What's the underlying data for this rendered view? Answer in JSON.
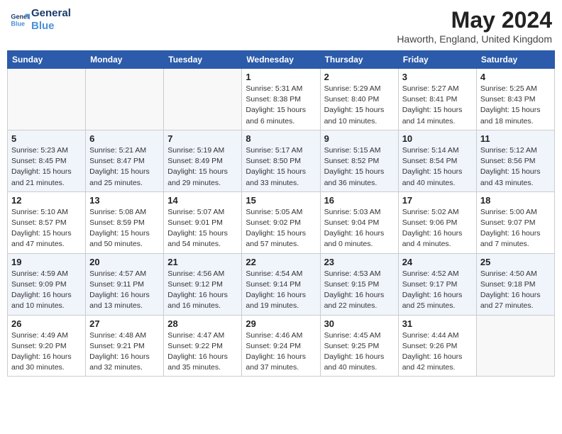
{
  "header": {
    "logo_line1": "General",
    "logo_line2": "Blue",
    "month_year": "May 2024",
    "location": "Haworth, England, United Kingdom"
  },
  "weekdays": [
    "Sunday",
    "Monday",
    "Tuesday",
    "Wednesday",
    "Thursday",
    "Friday",
    "Saturday"
  ],
  "weeks": [
    [
      {
        "day": "",
        "info": ""
      },
      {
        "day": "",
        "info": ""
      },
      {
        "day": "",
        "info": ""
      },
      {
        "day": "1",
        "info": "Sunrise: 5:31 AM\nSunset: 8:38 PM\nDaylight: 15 hours\nand 6 minutes."
      },
      {
        "day": "2",
        "info": "Sunrise: 5:29 AM\nSunset: 8:40 PM\nDaylight: 15 hours\nand 10 minutes."
      },
      {
        "day": "3",
        "info": "Sunrise: 5:27 AM\nSunset: 8:41 PM\nDaylight: 15 hours\nand 14 minutes."
      },
      {
        "day": "4",
        "info": "Sunrise: 5:25 AM\nSunset: 8:43 PM\nDaylight: 15 hours\nand 18 minutes."
      }
    ],
    [
      {
        "day": "5",
        "info": "Sunrise: 5:23 AM\nSunset: 8:45 PM\nDaylight: 15 hours\nand 21 minutes."
      },
      {
        "day": "6",
        "info": "Sunrise: 5:21 AM\nSunset: 8:47 PM\nDaylight: 15 hours\nand 25 minutes."
      },
      {
        "day": "7",
        "info": "Sunrise: 5:19 AM\nSunset: 8:49 PM\nDaylight: 15 hours\nand 29 minutes."
      },
      {
        "day": "8",
        "info": "Sunrise: 5:17 AM\nSunset: 8:50 PM\nDaylight: 15 hours\nand 33 minutes."
      },
      {
        "day": "9",
        "info": "Sunrise: 5:15 AM\nSunset: 8:52 PM\nDaylight: 15 hours\nand 36 minutes."
      },
      {
        "day": "10",
        "info": "Sunrise: 5:14 AM\nSunset: 8:54 PM\nDaylight: 15 hours\nand 40 minutes."
      },
      {
        "day": "11",
        "info": "Sunrise: 5:12 AM\nSunset: 8:56 PM\nDaylight: 15 hours\nand 43 minutes."
      }
    ],
    [
      {
        "day": "12",
        "info": "Sunrise: 5:10 AM\nSunset: 8:57 PM\nDaylight: 15 hours\nand 47 minutes."
      },
      {
        "day": "13",
        "info": "Sunrise: 5:08 AM\nSunset: 8:59 PM\nDaylight: 15 hours\nand 50 minutes."
      },
      {
        "day": "14",
        "info": "Sunrise: 5:07 AM\nSunset: 9:01 PM\nDaylight: 15 hours\nand 54 minutes."
      },
      {
        "day": "15",
        "info": "Sunrise: 5:05 AM\nSunset: 9:02 PM\nDaylight: 15 hours\nand 57 minutes."
      },
      {
        "day": "16",
        "info": "Sunrise: 5:03 AM\nSunset: 9:04 PM\nDaylight: 16 hours\nand 0 minutes."
      },
      {
        "day": "17",
        "info": "Sunrise: 5:02 AM\nSunset: 9:06 PM\nDaylight: 16 hours\nand 4 minutes."
      },
      {
        "day": "18",
        "info": "Sunrise: 5:00 AM\nSunset: 9:07 PM\nDaylight: 16 hours\nand 7 minutes."
      }
    ],
    [
      {
        "day": "19",
        "info": "Sunrise: 4:59 AM\nSunset: 9:09 PM\nDaylight: 16 hours\nand 10 minutes."
      },
      {
        "day": "20",
        "info": "Sunrise: 4:57 AM\nSunset: 9:11 PM\nDaylight: 16 hours\nand 13 minutes."
      },
      {
        "day": "21",
        "info": "Sunrise: 4:56 AM\nSunset: 9:12 PM\nDaylight: 16 hours\nand 16 minutes."
      },
      {
        "day": "22",
        "info": "Sunrise: 4:54 AM\nSunset: 9:14 PM\nDaylight: 16 hours\nand 19 minutes."
      },
      {
        "day": "23",
        "info": "Sunrise: 4:53 AM\nSunset: 9:15 PM\nDaylight: 16 hours\nand 22 minutes."
      },
      {
        "day": "24",
        "info": "Sunrise: 4:52 AM\nSunset: 9:17 PM\nDaylight: 16 hours\nand 25 minutes."
      },
      {
        "day": "25",
        "info": "Sunrise: 4:50 AM\nSunset: 9:18 PM\nDaylight: 16 hours\nand 27 minutes."
      }
    ],
    [
      {
        "day": "26",
        "info": "Sunrise: 4:49 AM\nSunset: 9:20 PM\nDaylight: 16 hours\nand 30 minutes."
      },
      {
        "day": "27",
        "info": "Sunrise: 4:48 AM\nSunset: 9:21 PM\nDaylight: 16 hours\nand 32 minutes."
      },
      {
        "day": "28",
        "info": "Sunrise: 4:47 AM\nSunset: 9:22 PM\nDaylight: 16 hours\nand 35 minutes."
      },
      {
        "day": "29",
        "info": "Sunrise: 4:46 AM\nSunset: 9:24 PM\nDaylight: 16 hours\nand 37 minutes."
      },
      {
        "day": "30",
        "info": "Sunrise: 4:45 AM\nSunset: 9:25 PM\nDaylight: 16 hours\nand 40 minutes."
      },
      {
        "day": "31",
        "info": "Sunrise: 4:44 AM\nSunset: 9:26 PM\nDaylight: 16 hours\nand 42 minutes."
      },
      {
        "day": "",
        "info": ""
      }
    ]
  ]
}
